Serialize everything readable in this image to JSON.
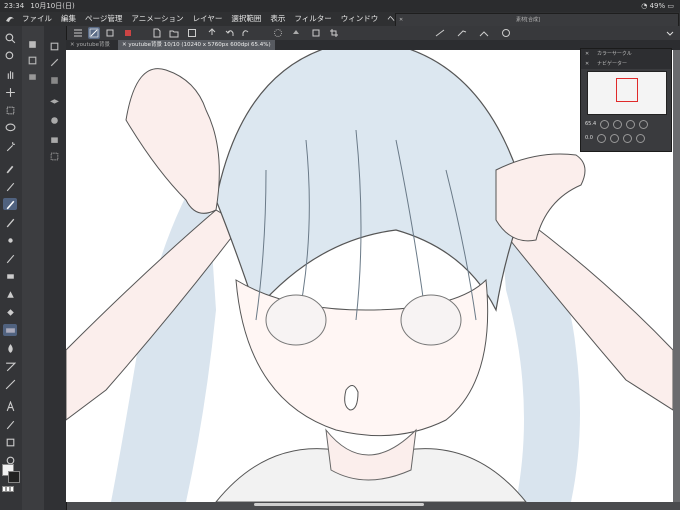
{
  "status": {
    "time": "23:34",
    "date": "10月10日(日)",
    "battery": "49%"
  },
  "menu": {
    "items": [
      "ファイル",
      "編集",
      "ページ管理",
      "アニメーション",
      "レイヤー",
      "選択範囲",
      "表示",
      "フィルター",
      "ウィンドウ",
      "ヘルプ"
    ],
    "floating_window_title": "素材[合成]"
  },
  "tabs": [
    {
      "label": "youtube背景"
    },
    {
      "label": "youtube背景 10/10 (10240 x 5760px 600dpi 65.4%)"
    }
  ],
  "panels": {
    "color_circle": "カラーサークル",
    "navigator": "ナビゲーター",
    "zoom": "65.4",
    "rotation": "0.0"
  },
  "colors": {
    "accent": "#50627f",
    "nav_frame": "#e02a2a",
    "background": "#4a4b4e"
  }
}
